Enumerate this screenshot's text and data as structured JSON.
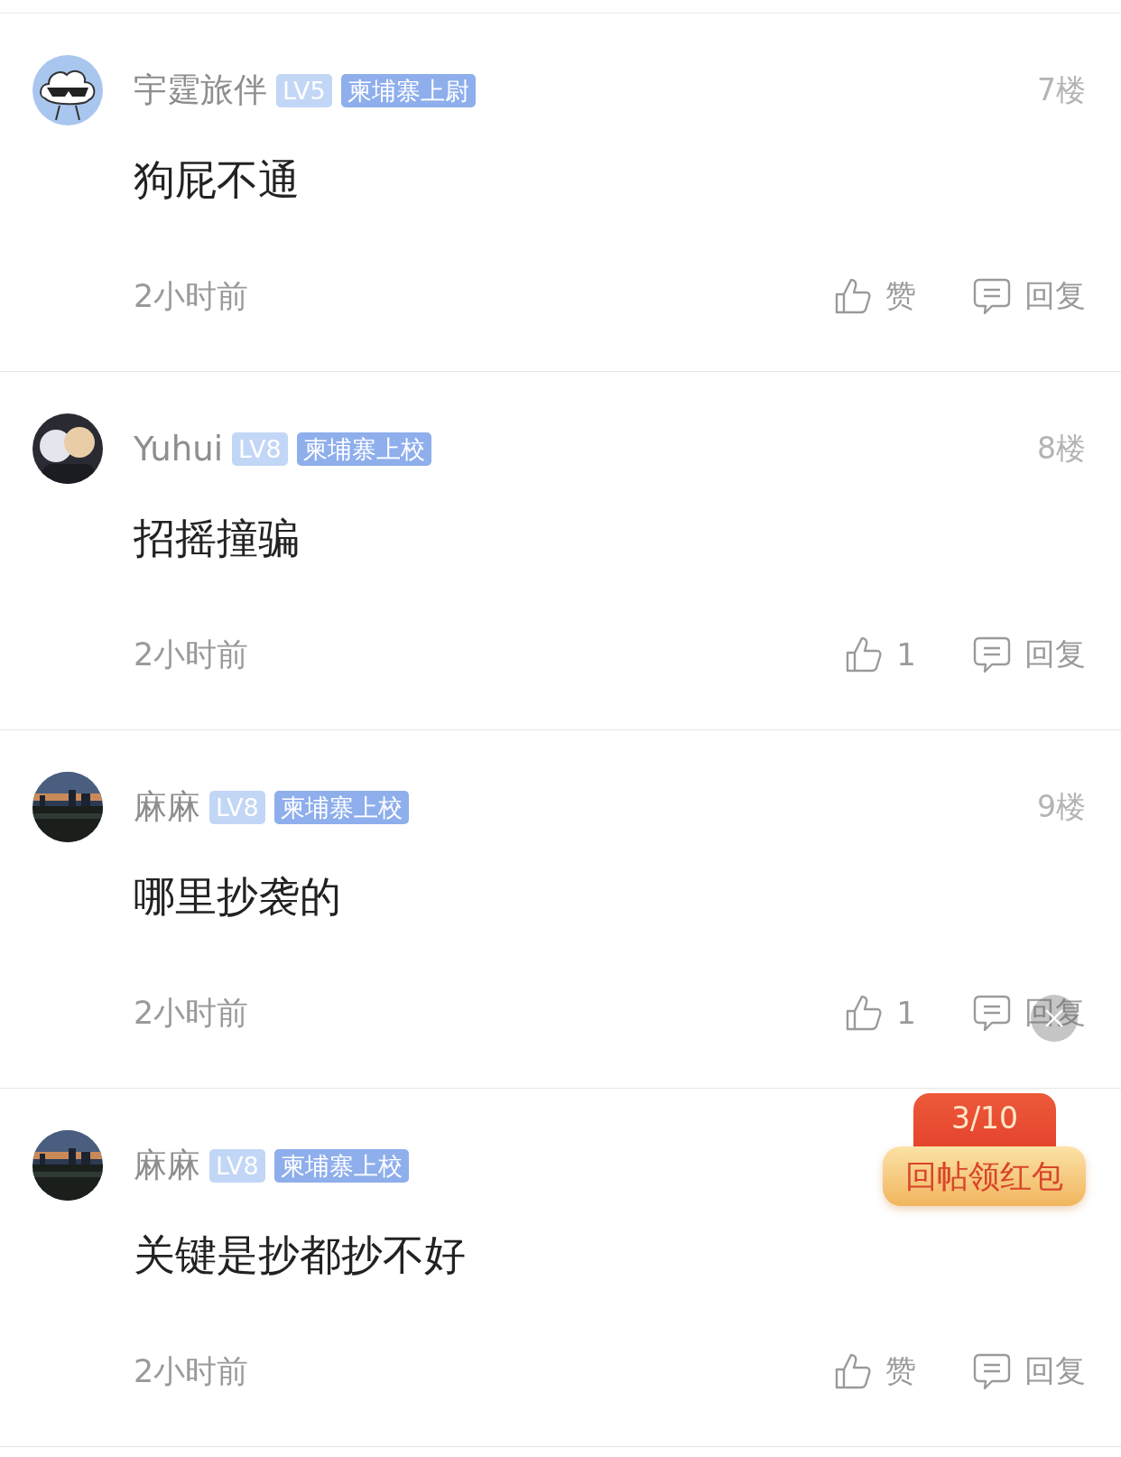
{
  "posts": [
    {
      "kind": "cloud",
      "name": "宇霆旅伴",
      "level_badge": "LV5",
      "rank_badge": "柬埔寨上尉",
      "floor": "7楼",
      "content": "狗屁不通",
      "time": "2小时前",
      "like": "赞",
      "reply": "回复"
    },
    {
      "kind": "figures",
      "name": "Yuhui",
      "level_badge": "LV8",
      "rank_badge": "柬埔寨上校",
      "floor": "8楼",
      "content": "招摇撞骗",
      "time": "2小时前",
      "like": "1",
      "reply": "回复"
    },
    {
      "kind": "picture",
      "name": "麻麻",
      "level_badge": "LV8",
      "rank_badge": "柬埔寨上校",
      "floor": "9楼",
      "content": "哪里抄袭的",
      "time": "2小时前",
      "like": "1",
      "reply": "回复"
    },
    {
      "kind": "picture",
      "name": "麻麻",
      "level_badge": "LV8",
      "rank_badge": "柬埔寨上校",
      "content": "关键是抄都抄不好",
      "time": "2小时前",
      "like": "赞",
      "reply": "回复"
    }
  ],
  "red_packet": {
    "progress": "3/10",
    "label": "回帖领红包"
  }
}
